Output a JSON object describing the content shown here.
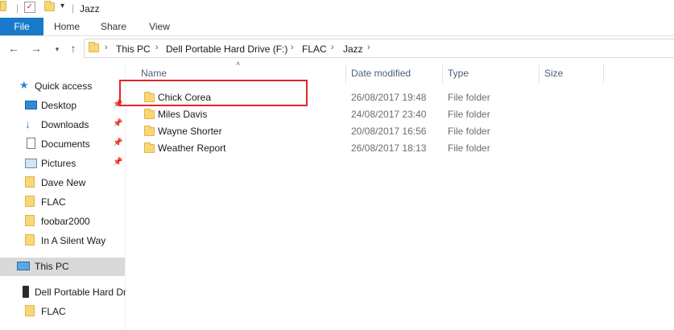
{
  "window": {
    "title": "Jazz"
  },
  "ribbon": {
    "tabs": [
      "File",
      "Home",
      "Share",
      "View"
    ]
  },
  "address": {
    "crumbs": [
      "This PC",
      "Dell Portable Hard Drive (F:)",
      "FLAC",
      "Jazz"
    ]
  },
  "sidebar": {
    "quick_access": "Quick access",
    "items": [
      {
        "label": "Desktop",
        "icon": "desktop-icon",
        "pinned": true
      },
      {
        "label": "Downloads",
        "icon": "download-icon",
        "pinned": true
      },
      {
        "label": "Documents",
        "icon": "documents-icon",
        "pinned": true
      },
      {
        "label": "Pictures",
        "icon": "pictures-icon",
        "pinned": true
      },
      {
        "label": "Dave New",
        "icon": "folder-icon",
        "pinned": false
      },
      {
        "label": "FLAC",
        "icon": "folder-icon",
        "pinned": false
      },
      {
        "label": "foobar2000",
        "icon": "folder-icon",
        "pinned": false
      },
      {
        "label": "In A Silent Way",
        "icon": "folder-icon",
        "pinned": false
      }
    ],
    "this_pc": "This PC",
    "drive": "Dell Portable Hard Dr",
    "drive_child": "FLAC"
  },
  "columns": {
    "name": "Name",
    "date": "Date modified",
    "type": "Type",
    "size": "Size"
  },
  "files": [
    {
      "name": "Chick Corea",
      "date": "26/08/2017 19:48",
      "type": "File folder"
    },
    {
      "name": "Miles Davis",
      "date": "24/08/2017 23:40",
      "type": "File folder"
    },
    {
      "name": "Wayne Shorter",
      "date": "20/08/2017 16:56",
      "type": "File folder"
    },
    {
      "name": "Weather Report",
      "date": "26/08/2017 18:13",
      "type": "File folder"
    }
  ],
  "colors": {
    "file_tab": "#1979ca",
    "highlight": "#e0252b",
    "selected_bg": "#cce8ff",
    "this_pc_bg": "#d9d9d9"
  }
}
